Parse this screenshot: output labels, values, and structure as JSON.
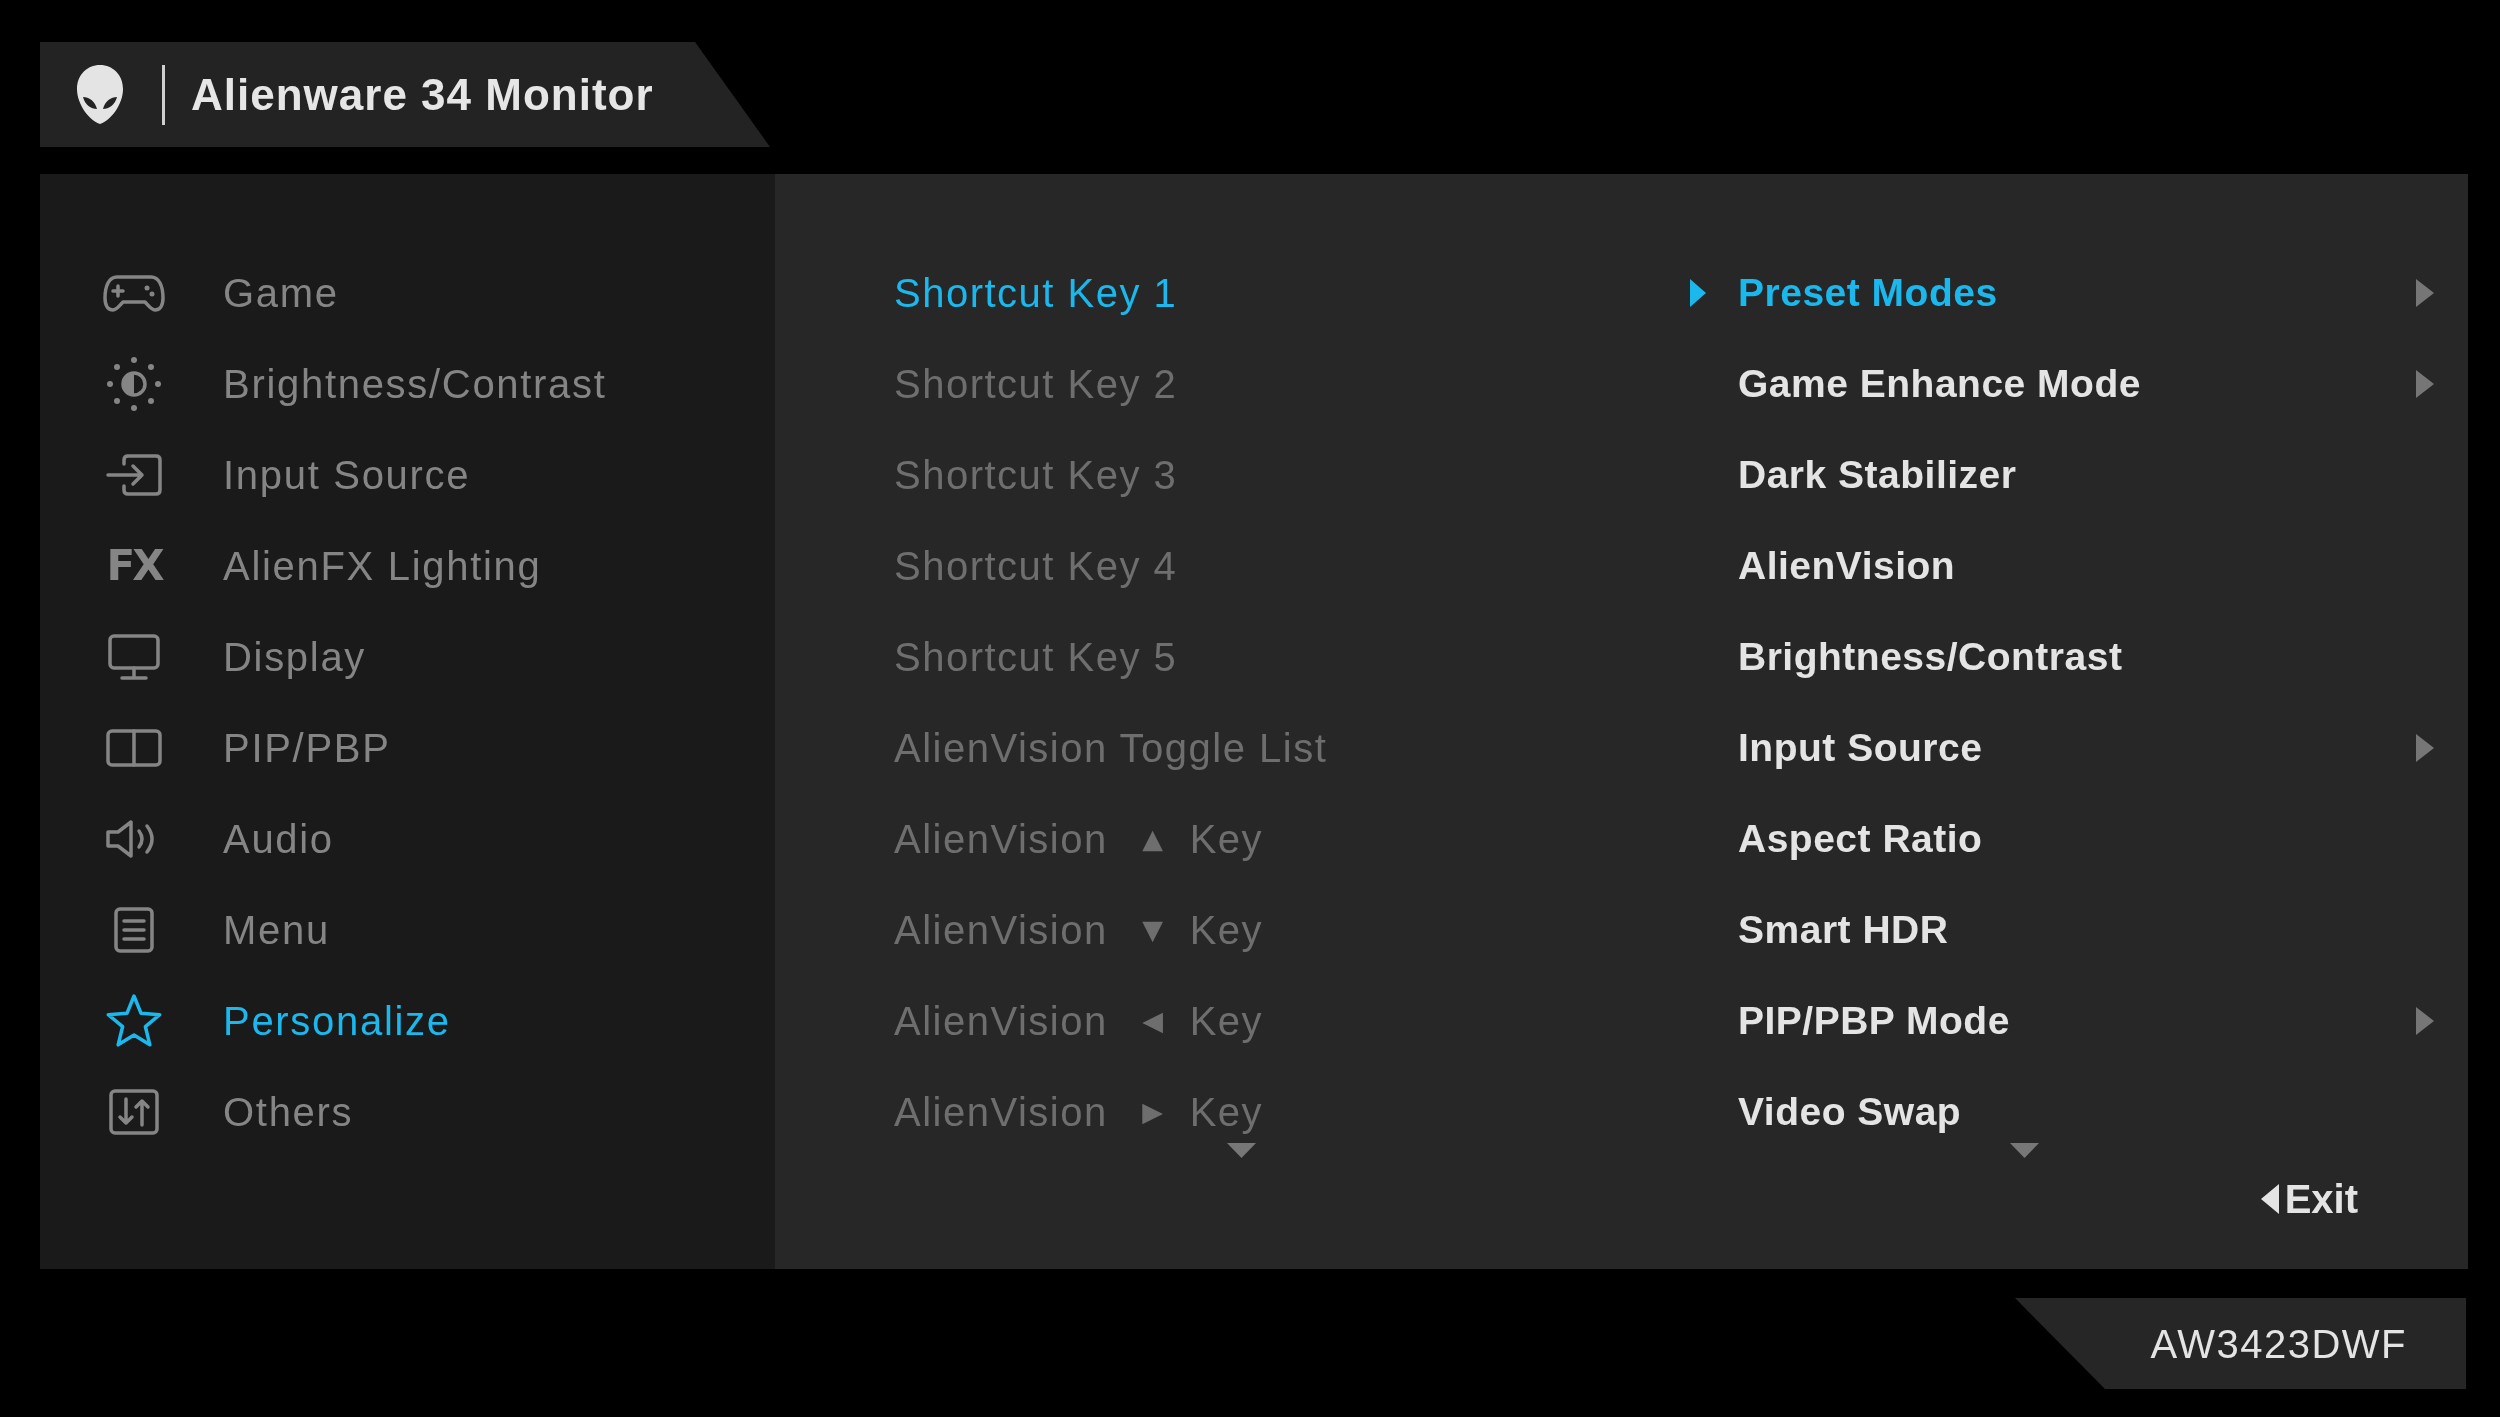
{
  "header": {
    "title": "Alienware 34 Monitor"
  },
  "sidebar": {
    "items": [
      {
        "label": "Game",
        "selected": false
      },
      {
        "label": "Brightness/Contrast",
        "selected": false
      },
      {
        "label": "Input Source",
        "selected": false
      },
      {
        "label": "AlienFX Lighting",
        "selected": false,
        "glyph": "FX"
      },
      {
        "label": "Display",
        "selected": false
      },
      {
        "label": "PIP/PBP",
        "selected": false
      },
      {
        "label": "Audio",
        "selected": false
      },
      {
        "label": "Menu",
        "selected": false
      },
      {
        "label": "Personalize",
        "selected": true
      },
      {
        "label": "Others",
        "selected": false
      }
    ]
  },
  "shortcut_keys": {
    "items": [
      {
        "label": "Shortcut Key 1",
        "selected": true
      },
      {
        "label": "Shortcut Key 2",
        "selected": false
      },
      {
        "label": "Shortcut Key 3",
        "selected": false
      },
      {
        "label": "Shortcut Key 4",
        "selected": false
      },
      {
        "label": "Shortcut Key 5",
        "selected": false
      },
      {
        "label": "AlienVision Toggle List",
        "selected": false
      },
      {
        "label": "AlienVision",
        "key_glyph": "▲",
        "suffix": "Key",
        "selected": false
      },
      {
        "label": "AlienVision",
        "key_glyph": "▼",
        "suffix": "Key",
        "selected": false
      },
      {
        "label": "AlienVision",
        "key_glyph": "◀",
        "suffix": "Key",
        "selected": false
      },
      {
        "label": "AlienVision",
        "key_glyph": "▶",
        "suffix": "Key",
        "selected": false
      }
    ],
    "more_below": true
  },
  "key_options": {
    "items": [
      {
        "label": "Preset Modes",
        "selected": true,
        "has_submenu": true
      },
      {
        "label": "Game Enhance Mode",
        "selected": false,
        "has_submenu": true
      },
      {
        "label": "Dark Stabilizer",
        "selected": false,
        "has_submenu": false
      },
      {
        "label": "AlienVision",
        "selected": false,
        "has_submenu": false
      },
      {
        "label": "Brightness/Contrast",
        "selected": false,
        "has_submenu": false
      },
      {
        "label": "Input Source",
        "selected": false,
        "has_submenu": true
      },
      {
        "label": "Aspect Ratio",
        "selected": false,
        "has_submenu": false
      },
      {
        "label": "Smart HDR",
        "selected": false,
        "has_submenu": false
      },
      {
        "label": "PIP/PBP Mode",
        "selected": false,
        "has_submenu": true
      },
      {
        "label": "Video Swap",
        "selected": false,
        "has_submenu": false
      }
    ],
    "more_below": true
  },
  "exit_button": {
    "label": "Exit"
  },
  "model": {
    "text": "AW3423DWF"
  }
}
